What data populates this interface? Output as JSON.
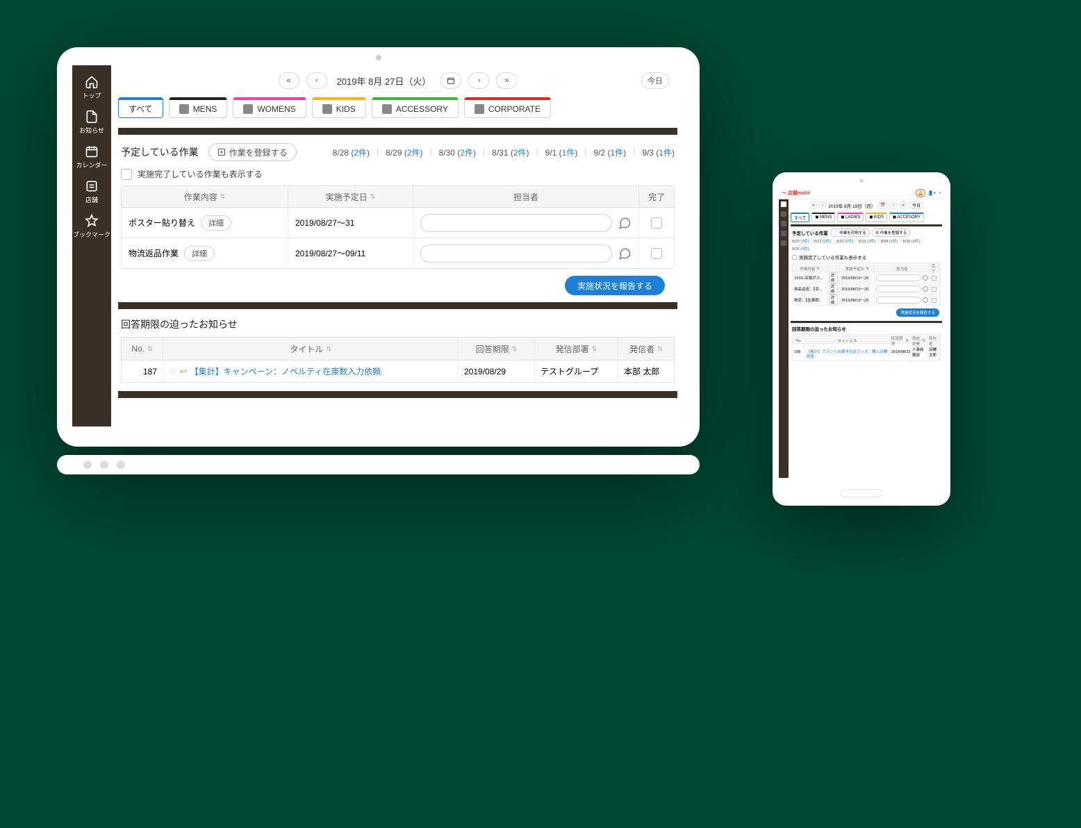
{
  "laptop": {
    "sidebar": {
      "items": [
        {
          "label": "トップ",
          "icon": "home-icon"
        },
        {
          "label": "お知らせ",
          "icon": "doc-icon"
        },
        {
          "label": "カレンダー",
          "icon": "calendar-icon"
        },
        {
          "label": "店舗",
          "icon": "store-icon"
        },
        {
          "label": "ブックマーク",
          "icon": "star-icon"
        }
      ]
    },
    "datebar": {
      "date": "2019年 8月 27日（火）",
      "today": "今日"
    },
    "categories": [
      {
        "label": "すべて",
        "color": "#1e7fd6"
      },
      {
        "label": "MENS",
        "color": "#222"
      },
      {
        "label": "WOMENS",
        "color": "#ff3aa8"
      },
      {
        "label": "KIDS",
        "color": "#ffb400"
      },
      {
        "label": "ACCESSORY",
        "color": "#2fbf2f"
      },
      {
        "label": "CORPORATE",
        "color": "#e22"
      }
    ],
    "tasks": {
      "title": "予定している作業",
      "register": "作業を登録する",
      "date_counts": [
        {
          "d": "8/28",
          "n": "2件"
        },
        {
          "d": "8/29",
          "n": "2件"
        },
        {
          "d": "8/30",
          "n": "2件"
        },
        {
          "d": "8/31",
          "n": "2件"
        },
        {
          "d": "9/1",
          "n": "1件"
        },
        {
          "d": "9/2",
          "n": "1件"
        },
        {
          "d": "9/3",
          "n": "1件"
        }
      ],
      "show_completed": "実施完了している作業も表示する",
      "columns": {
        "c1": "作業内容",
        "c2": "実施予定日",
        "c3": "担当者",
        "c4": "完了"
      },
      "detail_label": "詳細",
      "rows": [
        {
          "title": "ポスター貼り替え",
          "date": "2019/08/27〜31"
        },
        {
          "title": "物流返品作業",
          "date": "2019/08/27〜09/11"
        }
      ],
      "report": "実施状況を報告する"
    },
    "notices": {
      "title": "回答期限の迫ったお知らせ",
      "columns": {
        "c1": "No.",
        "c2": "タイトル",
        "c3": "回答期限",
        "c4": "発信部署",
        "c5": "発信者"
      },
      "rows": [
        {
          "no": "187",
          "title": "【集計】キャンペーン：ノベルティ在庫数入力依頼",
          "deadline": "2019/08/29",
          "dept": "テストグループ",
          "sender": "本部 太郎"
        }
      ]
    }
  },
  "phone": {
    "logo": "店舗matic",
    "datebar": {
      "date": "2019年 8月 19日（月）",
      "today": "今日"
    },
    "categories": [
      {
        "label": "すべて",
        "color": "#1e7fd6"
      },
      {
        "label": "MENS",
        "color": "#222"
      },
      {
        "label": "LADIES",
        "color": "#ff3aa8"
      },
      {
        "label": "KIDS",
        "color": "#ffb400"
      },
      {
        "label": "ACCESORY",
        "color": "#1e7fd6"
      }
    ],
    "tasks": {
      "title": "予定している作業",
      "print": "作業を印刷する",
      "register": "作業を登録する",
      "date_counts": [
        {
          "d": "8/20",
          "n": "3件"
        },
        {
          "d": "8/21",
          "n": "2件"
        },
        {
          "d": "8/22",
          "n": "2件"
        },
        {
          "d": "8/23",
          "n": "2件"
        },
        {
          "d": "8/24",
          "n": "2件"
        },
        {
          "d": "8/25",
          "n": "4件"
        },
        {
          "d": "8/26",
          "n": "4件"
        }
      ],
      "show_completed": "実施完了している作業も表示する",
      "columns": {
        "c1": "作業内容",
        "c2": "",
        "c3": "実施予定日",
        "c4": "担当者",
        "c5": "完了"
      },
      "detail_label": "詳細",
      "rows": [
        {
          "title": "19SS 店頭ポス...",
          "date": "2019/08/19〜20"
        },
        {
          "title": "商品返送：【収...",
          "date": "2019/08/19〜20"
        },
        {
          "title": "物流：【在庫調...",
          "date": "2019/08/19〜20"
        }
      ],
      "report": "実施状況を報告する"
    },
    "notices": {
      "title": "回答期限の迫ったお知らせ",
      "columns": {
        "c1": "No.",
        "c2": "タイトル",
        "c3": "回答期限",
        "c4": "発信部署",
        "c5": "発信者"
      },
      "rows": [
        {
          "no": "198",
          "title": "【集計】ブランド30周年記念グッズ：購入店舗調査",
          "deadline": "2019/08/22",
          "dept": "人事総務部",
          "sender": "店舗 太郎"
        }
      ]
    }
  }
}
